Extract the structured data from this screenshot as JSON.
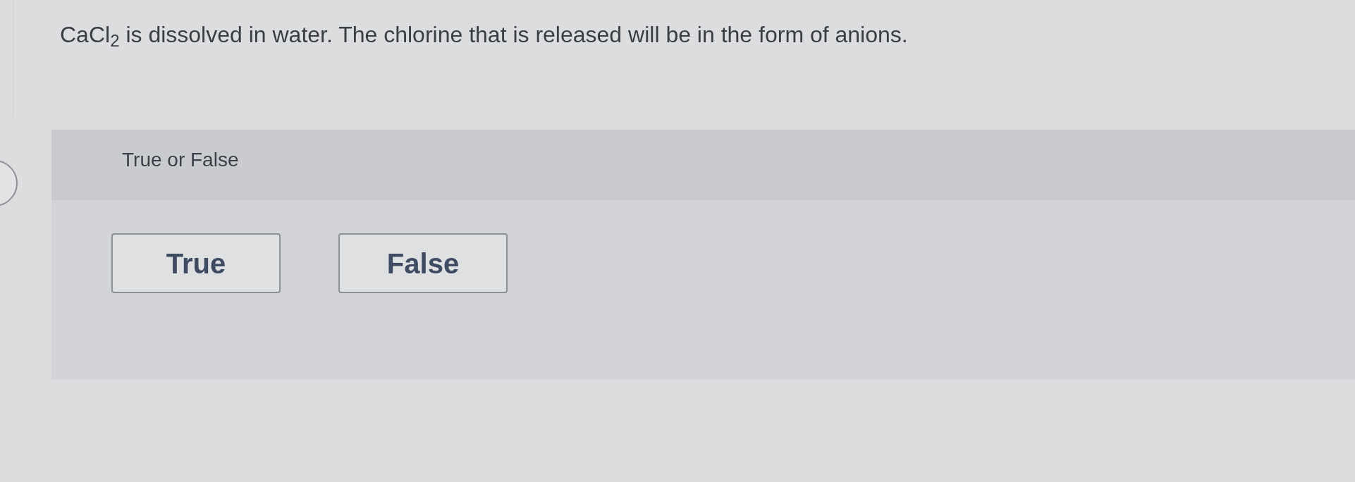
{
  "question": {
    "text": "CaCl$_{2}$ is dissolved in water. The chlorine that is released will be in the form of anions."
  },
  "answer_panel": {
    "prompt": "True or False",
    "options": [
      {
        "label": "True"
      },
      {
        "label": "False"
      }
    ]
  }
}
